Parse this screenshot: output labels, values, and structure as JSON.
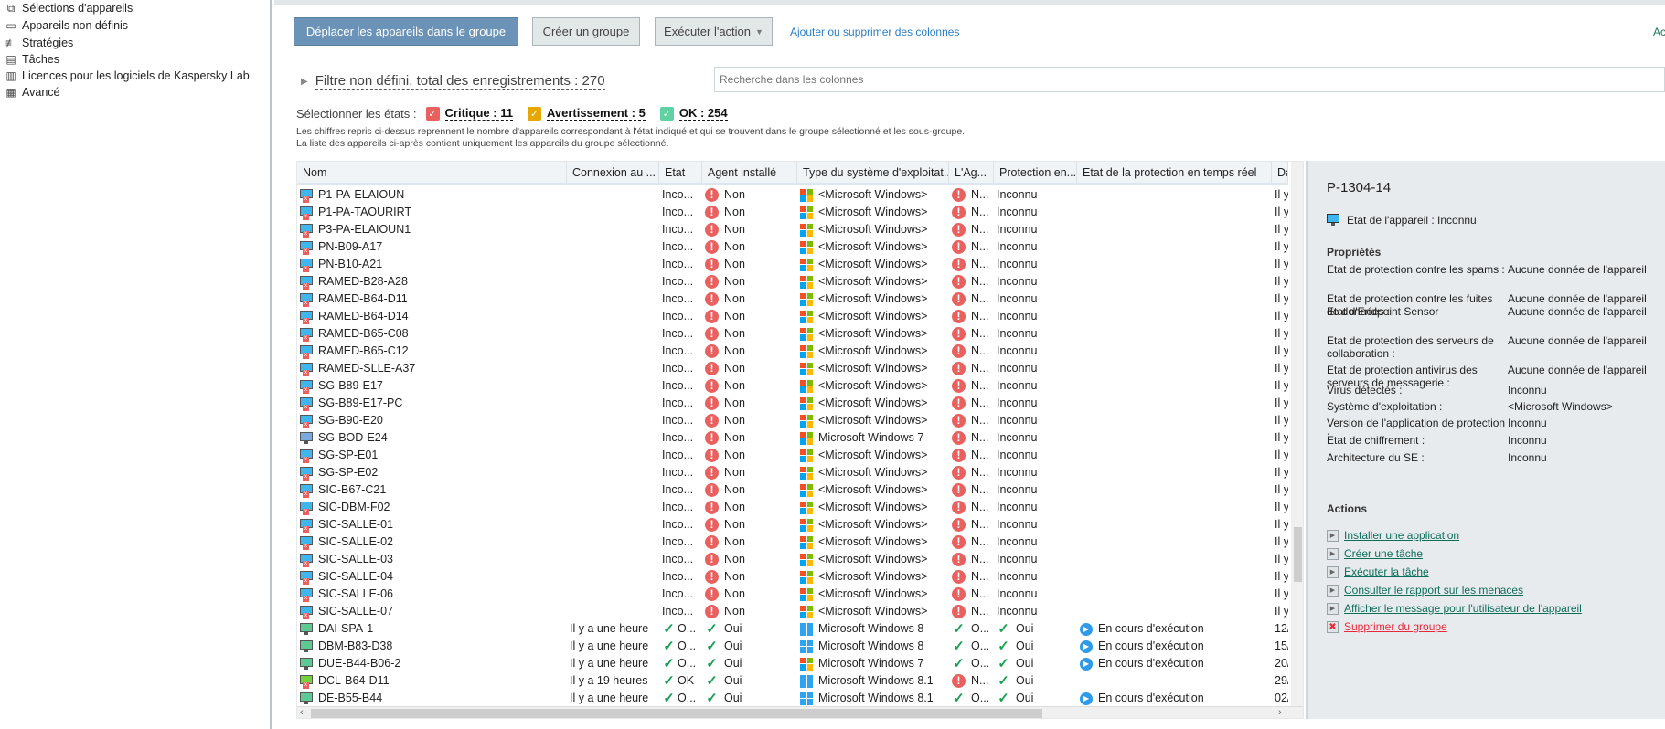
{
  "sidebar": {
    "items": [
      {
        "label": "Sélections d'appareils",
        "icon": "device-selection-icon"
      },
      {
        "label": "Appareils non définis",
        "icon": "unassigned-devices-icon"
      },
      {
        "label": "Stratégies",
        "icon": "policies-icon"
      },
      {
        "label": "Tâches",
        "icon": "tasks-icon"
      },
      {
        "label": "Licences pour les logiciels de Kaspersky Lab",
        "icon": "licenses-icon"
      },
      {
        "label": "Avancé",
        "icon": "advanced-icon"
      }
    ]
  },
  "toolbar": {
    "move": "Déplacer les appareils dans le groupe",
    "create_group": "Créer un groupe",
    "run_action": "Exécuter l'action",
    "add_remove_columns": "Ajouter ou supprimer des colonnes",
    "right_link": "Ac"
  },
  "filter": {
    "text": "Filtre non défini, total des enregistrements : 270",
    "search_placeholder": "Recherche dans les colonnes"
  },
  "states": {
    "label": "Sélectionner les états :",
    "critical": "Critique : 11",
    "warning": "Avertissement : 5",
    "ok": "OK : 254",
    "note1": "Les chiffres repris ci-dessus reprennent le nombre d'appareils correspondant à l'état indiqué et qui se trouvent dans le groupe sélectionné et les sous-groupe.",
    "note2": "La liste des appareils ci-après contient uniquement les appareils du groupe sélectionné.",
    "colors": {
      "critical": "#e8615f",
      "warning": "#e6a800",
      "ok": "#5fd1a3"
    }
  },
  "table": {
    "columns": [
      "Nom",
      "Connexion au ...",
      "Etat",
      "Agent installé",
      "Type du système d'exploitat...",
      "L'Ag...",
      "Protection en...",
      "Etat de la protection en temps réel",
      "Da"
    ],
    "rows": [
      {
        "name": "P1-PA-ELAIOUN",
        "dev": "x",
        "conn": "",
        "state": "Inco...",
        "agent": "Non",
        "os": "<Microsoft Windows>",
        "osi": "flag",
        "lag": "N...",
        "prot": "Inconnu",
        "rt": "",
        "date": "Il y"
      },
      {
        "name": "P1-PA-TAOURIRT",
        "dev": "x",
        "conn": "",
        "state": "Inco...",
        "agent": "Non",
        "os": "<Microsoft Windows>",
        "osi": "flag",
        "lag": "N...",
        "prot": "Inconnu",
        "rt": "",
        "date": "Il y"
      },
      {
        "name": "P3-PA-ELAIOUN1",
        "dev": "x",
        "conn": "",
        "state": "Inco...",
        "agent": "Non",
        "os": "<Microsoft Windows>",
        "osi": "flag",
        "lag": "N...",
        "prot": "Inconnu",
        "rt": "",
        "date": "Il y"
      },
      {
        "name": "PN-B09-A17",
        "dev": "x",
        "conn": "",
        "state": "Inco...",
        "agent": "Non",
        "os": "<Microsoft Windows>",
        "osi": "flag",
        "lag": "N...",
        "prot": "Inconnu",
        "rt": "",
        "date": "Il y"
      },
      {
        "name": "PN-B10-A21",
        "dev": "x",
        "conn": "",
        "state": "Inco...",
        "agent": "Non",
        "os": "<Microsoft Windows>",
        "osi": "flag",
        "lag": "N...",
        "prot": "Inconnu",
        "rt": "",
        "date": "Il y"
      },
      {
        "name": "RAMED-B28-A28",
        "dev": "x",
        "conn": "",
        "state": "Inco...",
        "agent": "Non",
        "os": "<Microsoft Windows>",
        "osi": "flag",
        "lag": "N...",
        "prot": "Inconnu",
        "rt": "",
        "date": "Il y"
      },
      {
        "name": "RAMED-B64-D11",
        "dev": "x",
        "conn": "",
        "state": "Inco...",
        "agent": "Non",
        "os": "<Microsoft Windows>",
        "osi": "flag",
        "lag": "N...",
        "prot": "Inconnu",
        "rt": "",
        "date": "Il y"
      },
      {
        "name": "RAMED-B64-D14",
        "dev": "x",
        "conn": "",
        "state": "Inco...",
        "agent": "Non",
        "os": "<Microsoft Windows>",
        "osi": "flag",
        "lag": "N...",
        "prot": "Inconnu",
        "rt": "",
        "date": "Il y"
      },
      {
        "name": "RAMED-B65-C08",
        "dev": "x",
        "conn": "",
        "state": "Inco...",
        "agent": "Non",
        "os": "<Microsoft Windows>",
        "osi": "flag",
        "lag": "N...",
        "prot": "Inconnu",
        "rt": "",
        "date": "Il y"
      },
      {
        "name": "RAMED-B65-C12",
        "dev": "x",
        "conn": "",
        "state": "Inco...",
        "agent": "Non",
        "os": "<Microsoft Windows>",
        "osi": "flag",
        "lag": "N...",
        "prot": "Inconnu",
        "rt": "",
        "date": "Il y"
      },
      {
        "name": "RAMED-SLLE-A37",
        "dev": "x",
        "conn": "",
        "state": "Inco...",
        "agent": "Non",
        "os": "<Microsoft Windows>",
        "osi": "flag",
        "lag": "N...",
        "prot": "Inconnu",
        "rt": "",
        "date": "Il y"
      },
      {
        "name": "SG-B89-E17",
        "dev": "x",
        "conn": "",
        "state": "Inco...",
        "agent": "Non",
        "os": "<Microsoft Windows>",
        "osi": "flag",
        "lag": "N...",
        "prot": "Inconnu",
        "rt": "",
        "date": "Il y"
      },
      {
        "name": "SG-B89-E17-PC",
        "dev": "x",
        "conn": "",
        "state": "Inco...",
        "agent": "Non",
        "os": "<Microsoft Windows>",
        "osi": "flag",
        "lag": "N...",
        "prot": "Inconnu",
        "rt": "",
        "date": "Il y"
      },
      {
        "name": "SG-B90-E20",
        "dev": "x",
        "conn": "",
        "state": "Inco...",
        "agent": "Non",
        "os": "<Microsoft Windows>",
        "osi": "flag",
        "lag": "N...",
        "prot": "Inconnu",
        "rt": "",
        "date": "Il y"
      },
      {
        "name": "SG-BOD-E24",
        "dev": "plain",
        "conn": "",
        "state": "Inco...",
        "agent": "Non",
        "os": "Microsoft Windows 7",
        "osi": "flag",
        "lag": "N...",
        "prot": "Inconnu",
        "rt": "",
        "date": "Il y"
      },
      {
        "name": "SG-SP-E01",
        "dev": "x",
        "conn": "",
        "state": "Inco...",
        "agent": "Non",
        "os": "<Microsoft Windows>",
        "osi": "flag",
        "lag": "N...",
        "prot": "Inconnu",
        "rt": "",
        "date": "Il y"
      },
      {
        "name": "SG-SP-E02",
        "dev": "x",
        "conn": "",
        "state": "Inco...",
        "agent": "Non",
        "os": "<Microsoft Windows>",
        "osi": "flag",
        "lag": "N...",
        "prot": "Inconnu",
        "rt": "",
        "date": "Il y"
      },
      {
        "name": "SIC-B67-C21",
        "dev": "x",
        "conn": "",
        "state": "Inco...",
        "agent": "Non",
        "os": "<Microsoft Windows>",
        "osi": "flag",
        "lag": "N...",
        "prot": "Inconnu",
        "rt": "",
        "date": "Il y"
      },
      {
        "name": "SIC-DBM-F02",
        "dev": "x",
        "conn": "",
        "state": "Inco...",
        "agent": "Non",
        "os": "<Microsoft Windows>",
        "osi": "flag",
        "lag": "N...",
        "prot": "Inconnu",
        "rt": "",
        "date": "Il y"
      },
      {
        "name": "SIC-SALLE-01",
        "dev": "x",
        "conn": "",
        "state": "Inco...",
        "agent": "Non",
        "os": "<Microsoft Windows>",
        "osi": "flag",
        "lag": "N...",
        "prot": "Inconnu",
        "rt": "",
        "date": "Il y"
      },
      {
        "name": "SIC-SALLE-02",
        "dev": "x",
        "conn": "",
        "state": "Inco...",
        "agent": "Non",
        "os": "<Microsoft Windows>",
        "osi": "flag",
        "lag": "N...",
        "prot": "Inconnu",
        "rt": "",
        "date": "Il y"
      },
      {
        "name": "SIC-SALLE-03",
        "dev": "x",
        "conn": "",
        "state": "Inco...",
        "agent": "Non",
        "os": "<Microsoft Windows>",
        "osi": "flag",
        "lag": "N...",
        "prot": "Inconnu",
        "rt": "",
        "date": "Il y"
      },
      {
        "name": "SIC-SALLE-04",
        "dev": "x",
        "conn": "",
        "state": "Inco...",
        "agent": "Non",
        "os": "<Microsoft Windows>",
        "osi": "flag",
        "lag": "N...",
        "prot": "Inconnu",
        "rt": "",
        "date": "Il y"
      },
      {
        "name": "SIC-SALLE-06",
        "dev": "x",
        "conn": "",
        "state": "Inco...",
        "agent": "Non",
        "os": "<Microsoft Windows>",
        "osi": "flag",
        "lag": "N...",
        "prot": "Inconnu",
        "rt": "",
        "date": "Il y"
      },
      {
        "name": "SIC-SALLE-07",
        "dev": "x",
        "conn": "",
        "state": "Inco...",
        "agent": "Non",
        "os": "<Microsoft Windows>",
        "osi": "flag",
        "lag": "N...",
        "prot": "Inconnu",
        "rt": "",
        "date": "Il y"
      },
      {
        "name": "DAI-SPA-1",
        "dev": "green",
        "conn": "Il y a une heure",
        "state": "O...",
        "ok": true,
        "agent": "Oui",
        "os": "Microsoft Windows 8",
        "osi": "win8",
        "lag": "O...",
        "lagok": true,
        "prot": "Oui",
        "protok": true,
        "rt": "En cours d'exécution",
        "date": "12/"
      },
      {
        "name": "DBM-B83-D38",
        "dev": "green",
        "conn": "Il y a une heure",
        "state": "O...",
        "ok": true,
        "agent": "Oui",
        "os": "Microsoft Windows 8",
        "osi": "win8",
        "lag": "O...",
        "lagok": true,
        "prot": "Oui",
        "protok": true,
        "rt": "En cours d'exécution",
        "date": "15/"
      },
      {
        "name": "DUE-B44-B06-2",
        "dev": "green",
        "conn": "Il y a une heure",
        "state": "O...",
        "ok": true,
        "agent": "Oui",
        "os": "Microsoft Windows 7",
        "osi": "flag",
        "lag": "O...",
        "lagok": true,
        "prot": "Oui",
        "protok": true,
        "rt": "En cours d'exécution",
        "date": "20/"
      },
      {
        "name": "DCL-B64-D11",
        "dev": "greenx",
        "conn": "Il y a 19 heures",
        "state": "OK",
        "ok": true,
        "agent": "Oui",
        "os": "Microsoft Windows 8.1",
        "osi": "win8",
        "lag": "N...",
        "lagok": false,
        "prot": "Oui",
        "protok": true,
        "rt": "",
        "date": "29/"
      },
      {
        "name": "DE-B55-B44",
        "dev": "green",
        "conn": "Il y a une heure",
        "state": "O...",
        "ok": true,
        "agent": "Oui",
        "os": "Microsoft Windows 8.1",
        "osi": "win8",
        "lag": "O...",
        "lagok": true,
        "prot": "Oui",
        "protok": true,
        "rt": "En cours d'exécution",
        "date": "02/"
      }
    ]
  },
  "panel": {
    "title": "P-1304-14",
    "device_state": "Etat de l'appareil : Inconnu",
    "properties_heading": "Propriétés",
    "properties": [
      {
        "k": "Etat de protection contre les spams :",
        "v": "Aucune donnée de l'appareil"
      },
      {
        "k": "Etat de protection contre les fuites de données :",
        "v": "Aucune donnée de l'appareil"
      },
      {
        "k": "Etat d'Endpoint Sensor",
        "v": "Aucune donnée de l'appareil"
      },
      {
        "k": "Etat de protection des serveurs de collaboration :",
        "v": "Aucune donnée de l'appareil"
      },
      {
        "k": "Etat de protection antivirus des serveurs de messagerie :",
        "v": "Aucune donnée de l'appareil"
      },
      {
        "k": "Virus détectés :",
        "v": "Inconnu"
      },
      {
        "k": "Système d'exploitation :",
        "v": "<Microsoft Windows>"
      },
      {
        "k": "Version de l'application de protection :",
        "v": "Inconnu"
      },
      {
        "k": "Etat de chiffrement :",
        "v": "Inconnu"
      },
      {
        "k": "Architecture du SE :",
        "v": "Inconnu"
      }
    ],
    "actions_heading": "Actions",
    "actions": [
      "Installer une application",
      "Créer une tâche",
      "Exécuter la tâche",
      "Consulter le rapport sur les menaces",
      "Afficher le message pour l'utilisateur de l'appareil",
      "Supprimer du groupe"
    ]
  }
}
